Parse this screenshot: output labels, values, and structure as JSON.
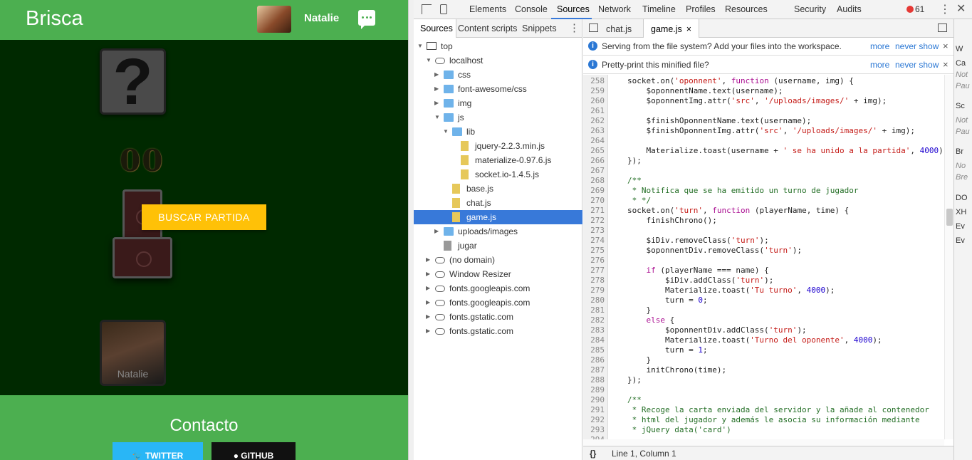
{
  "app": {
    "title": "Brisca",
    "user_name": "Natalie",
    "score": "00",
    "find_button": "BUSCAR PARTIDA",
    "player_label": "Natalie",
    "contact_title": "Contacto",
    "twitter_label": "TWITTER",
    "github_label": "GITHUB"
  },
  "devtools": {
    "tabs": [
      "Elements",
      "Console",
      "Sources",
      "Network",
      "Timeline",
      "Profiles",
      "Resources",
      "Security",
      "Audits"
    ],
    "active_tab": "Sources",
    "error_count": "61",
    "navigator_tabs": [
      "Sources",
      "Content scripts",
      "Snippets"
    ],
    "tree": [
      {
        "label": "top",
        "type": "frame",
        "depth": 0,
        "open": true
      },
      {
        "label": "localhost",
        "type": "cloud",
        "depth": 1,
        "open": true
      },
      {
        "label": "css",
        "type": "folder",
        "depth": 2,
        "open": false
      },
      {
        "label": "font-awesome/css",
        "type": "folder",
        "depth": 2,
        "open": false
      },
      {
        "label": "img",
        "type": "folder",
        "depth": 2,
        "open": false
      },
      {
        "label": "js",
        "type": "folder",
        "depth": 2,
        "open": true
      },
      {
        "label": "lib",
        "type": "folder",
        "depth": 3,
        "open": true
      },
      {
        "label": "jquery-2.2.3.min.js",
        "type": "file",
        "depth": 4
      },
      {
        "label": "materialize-0.97.6.js",
        "type": "file",
        "depth": 4
      },
      {
        "label": "socket.io-1.4.5.js",
        "type": "file",
        "depth": 4
      },
      {
        "label": "base.js",
        "type": "file",
        "depth": 3
      },
      {
        "label": "chat.js",
        "type": "file",
        "depth": 3
      },
      {
        "label": "game.js",
        "type": "file",
        "depth": 3,
        "selected": true
      },
      {
        "label": "uploads/images",
        "type": "folder",
        "depth": 2,
        "open": false
      },
      {
        "label": "jugar",
        "type": "plain",
        "depth": 2
      },
      {
        "label": "(no domain)",
        "type": "cloud",
        "depth": 1,
        "open": false
      },
      {
        "label": "Window Resizer",
        "type": "cloud",
        "depth": 1,
        "open": false
      },
      {
        "label": "fonts.googleapis.com",
        "type": "cloud",
        "depth": 1,
        "open": false
      },
      {
        "label": "fonts.googleapis.com",
        "type": "cloud",
        "depth": 1,
        "open": false
      },
      {
        "label": "fonts.gstatic.com",
        "type": "cloud",
        "depth": 1,
        "open": false
      },
      {
        "label": "fonts.gstatic.com",
        "type": "cloud",
        "depth": 1,
        "open": false
      }
    ],
    "editor_tabs": [
      "chat.js",
      "game.js"
    ],
    "close_glyph": "×",
    "infobar1": {
      "msg": "Serving from the file system? Add your files into the workspace.",
      "more": "more",
      "never": "never show"
    },
    "infobar2": {
      "msg": "Pretty-print this minified file?",
      "more": "more",
      "never": "never show"
    },
    "code_lines": [
      {
        "n": "258",
        "t": "socket.on('oponnent', function (username, img) {"
      },
      {
        "n": "259",
        "t": "    $oponnentName.text(username);"
      },
      {
        "n": "260",
        "t": "    $oponnentImg.attr('src', '/uploads/images/' + img);"
      },
      {
        "n": "261",
        "t": ""
      },
      {
        "n": "262",
        "t": "    $finishOponnentName.text(username);"
      },
      {
        "n": "263",
        "t": "    $finishOponnentImg.attr('src', '/uploads/images/' + img);"
      },
      {
        "n": "264",
        "t": ""
      },
      {
        "n": "265",
        "t": "    Materialize.toast(username + ' se ha unido a la partida', 4000);"
      },
      {
        "n": "266",
        "t": "});"
      },
      {
        "n": "267",
        "t": ""
      },
      {
        "n": "268",
        "t": "/**"
      },
      {
        "n": "269",
        "t": " * Notifica que se ha emitido un turno de jugador"
      },
      {
        "n": "270",
        "t": " * */"
      },
      {
        "n": "271",
        "t": "socket.on('turn', function (playerName, time) {"
      },
      {
        "n": "272",
        "t": "    finishChrono();"
      },
      {
        "n": "273",
        "t": ""
      },
      {
        "n": "274",
        "t": "    $iDiv.removeClass('turn');"
      },
      {
        "n": "275",
        "t": "    $oponnentDiv.removeClass('turn');"
      },
      {
        "n": "276",
        "t": ""
      },
      {
        "n": "277",
        "t": "    if (playerName === name) {"
      },
      {
        "n": "278",
        "t": "        $iDiv.addClass('turn');"
      },
      {
        "n": "279",
        "t": "        Materialize.toast('Tu turno', 4000);"
      },
      {
        "n": "280",
        "t": "        turn = 0;"
      },
      {
        "n": "281",
        "t": "    }"
      },
      {
        "n": "282",
        "t": "    else {"
      },
      {
        "n": "283",
        "t": "        $oponnentDiv.addClass('turn');"
      },
      {
        "n": "284",
        "t": "        Materialize.toast('Turno del oponente', 4000);"
      },
      {
        "n": "285",
        "t": "        turn = 1;"
      },
      {
        "n": "286",
        "t": "    }"
      },
      {
        "n": "287",
        "t": "    initChrono(time);"
      },
      {
        "n": "288",
        "t": "});"
      },
      {
        "n": "289",
        "t": ""
      },
      {
        "n": "290",
        "t": "/**"
      },
      {
        "n": "291",
        "t": " * Recoge la carta enviada del servidor y la añade al contenedor"
      },
      {
        "n": "292",
        "t": " * html del jugador y además le asocia su información mediante"
      },
      {
        "n": "293",
        "t": " * jQuery data('card')"
      },
      {
        "n": "294",
        "t": ""
      }
    ],
    "status_text": "Line 1, Column 1",
    "status_braces": "{}",
    "right_panel": [
      "W",
      "Ca",
      "Not",
      "Pau",
      "Sc",
      "Not",
      "Pau",
      "Br",
      "No",
      "Bre",
      "DO",
      "XH",
      "Ev",
      "Ev"
    ]
  }
}
